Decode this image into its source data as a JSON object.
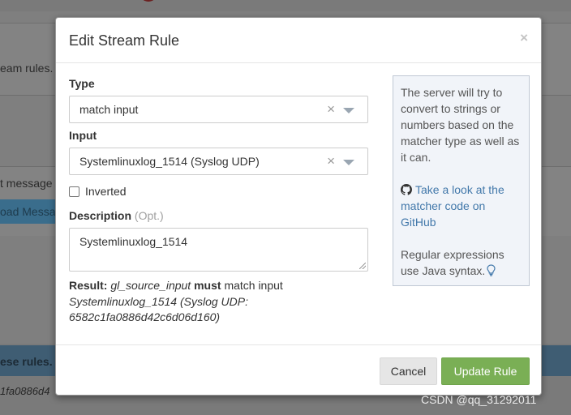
{
  "background": {
    "text_rules": "eam rules.",
    "text_message": "t message",
    "button_load": "oad Messa",
    "header_text": "ese rules.",
    "row_text": "1fa0886d4"
  },
  "modal": {
    "title": "Edit Stream Rule",
    "close": "×",
    "type_label": "Type",
    "type_value": "match input",
    "input_label": "Input",
    "input_value": "Systemlinuxlog_1514 (Syslog UDP)",
    "clear_glyph": "×",
    "inverted_label": "Inverted",
    "description_label": "Description",
    "description_opt": "(Opt.)",
    "description_value": "Systemlinuxlog_1514",
    "result": {
      "prefix": "Result:",
      "field": "gl_source_input",
      "must": "must",
      "rule": "match input",
      "target": "Systemlinuxlog_1514 (Syslog UDP: 6582c1fa0886d42c6d06d160)"
    },
    "help": {
      "text": "The server will try to convert to strings or numbers based on the matcher type as well as it can.",
      "link": "Take a look at the matcher code on GitHub",
      "regex": "Regular expressions use Java syntax."
    },
    "cancel_label": "Cancel",
    "update_label": "Update Rule"
  },
  "watermark": "CSDN @qq_31292011",
  "colors": {
    "primary_green": "#7aaf55",
    "link_blue": "#4278aa",
    "help_bg": "#f1f4f9"
  }
}
